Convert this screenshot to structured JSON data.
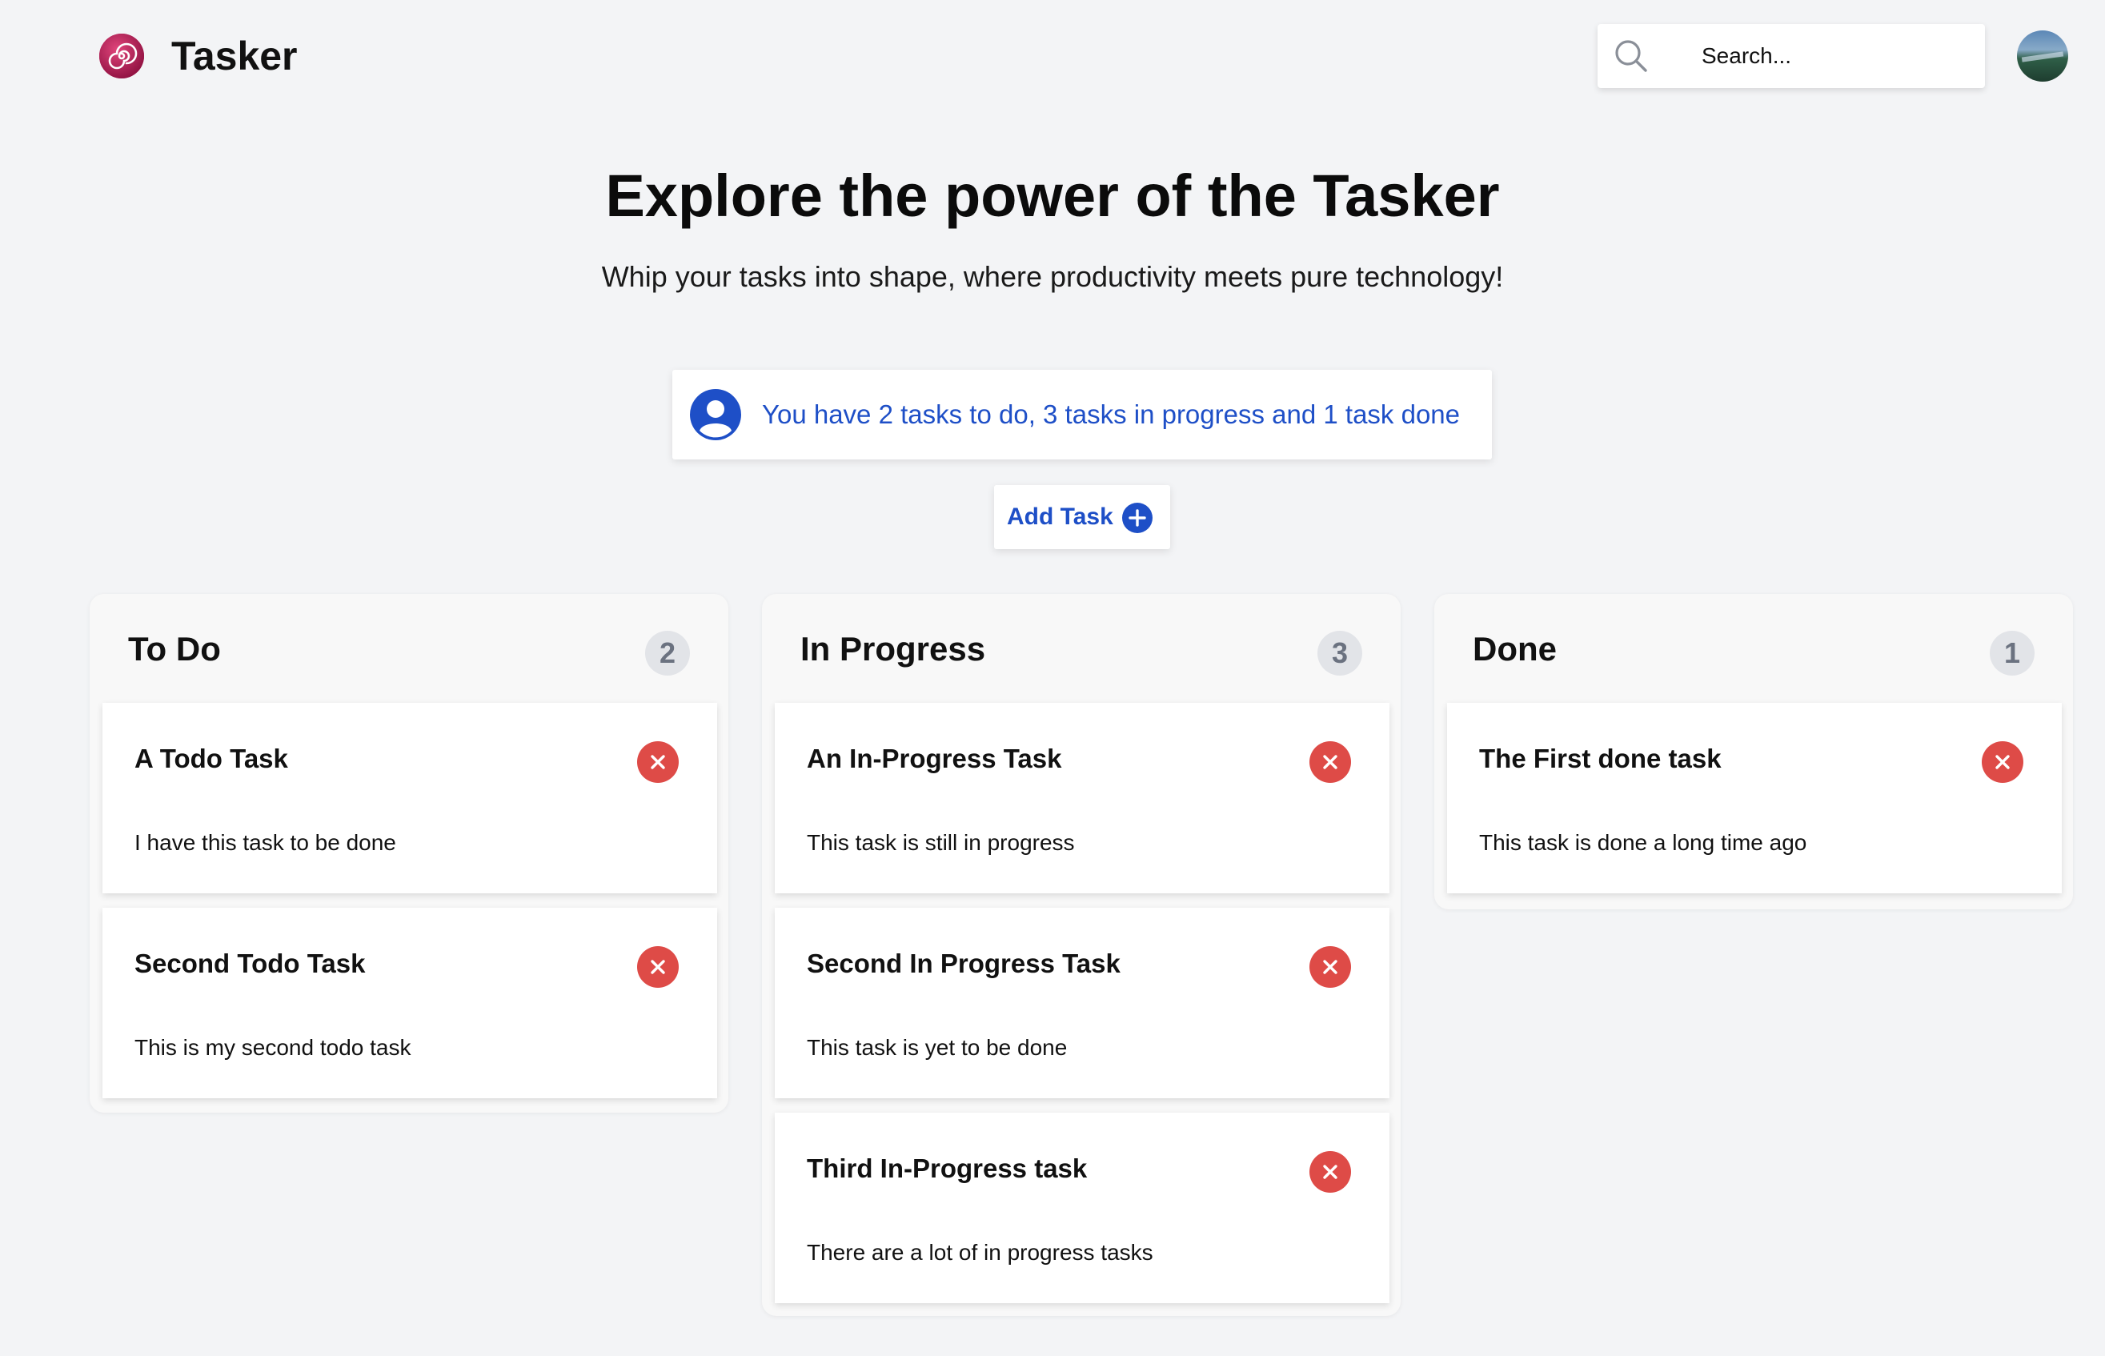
{
  "header": {
    "brand": "Tasker",
    "logo_icon": "spiral-logo-icon",
    "search_placeholder": "Search...",
    "search_icon": "search-icon",
    "avatar_icon": "avatar-image"
  },
  "hero": {
    "title": "Explore the power of the Tasker",
    "subtitle": "Whip your tasks into shape, where productivity meets pure technology!"
  },
  "summary": {
    "icon": "user-circle-icon",
    "text": "You have 2 tasks to do, 3 tasks in progress and 1 task done"
  },
  "add_task": {
    "label": "Add Task",
    "icon": "plus-circle-icon"
  },
  "colors": {
    "accent_blue": "#1e4fc7",
    "delete_red": "#de4b47",
    "background": "#f3f4f6",
    "logo": "#c2185b"
  },
  "columns": [
    {
      "title": "To Do",
      "count": "2",
      "tasks": [
        {
          "title": "A Todo Task",
          "description": "I have this task to be done"
        },
        {
          "title": "Second Todo Task",
          "description": "This is my second todo task"
        }
      ]
    },
    {
      "title": "In Progress",
      "count": "3",
      "tasks": [
        {
          "title": "An In-Progress Task",
          "description": "This task is still in progress"
        },
        {
          "title": "Second In Progress Task",
          "description": "This task is yet to be done"
        },
        {
          "title": "Third In-Progress task",
          "description": "There are a lot of in progress tasks"
        }
      ]
    },
    {
      "title": "Done",
      "count": "1",
      "tasks": [
        {
          "title": "The First done task",
          "description": "This task is done a long time ago"
        }
      ]
    }
  ]
}
